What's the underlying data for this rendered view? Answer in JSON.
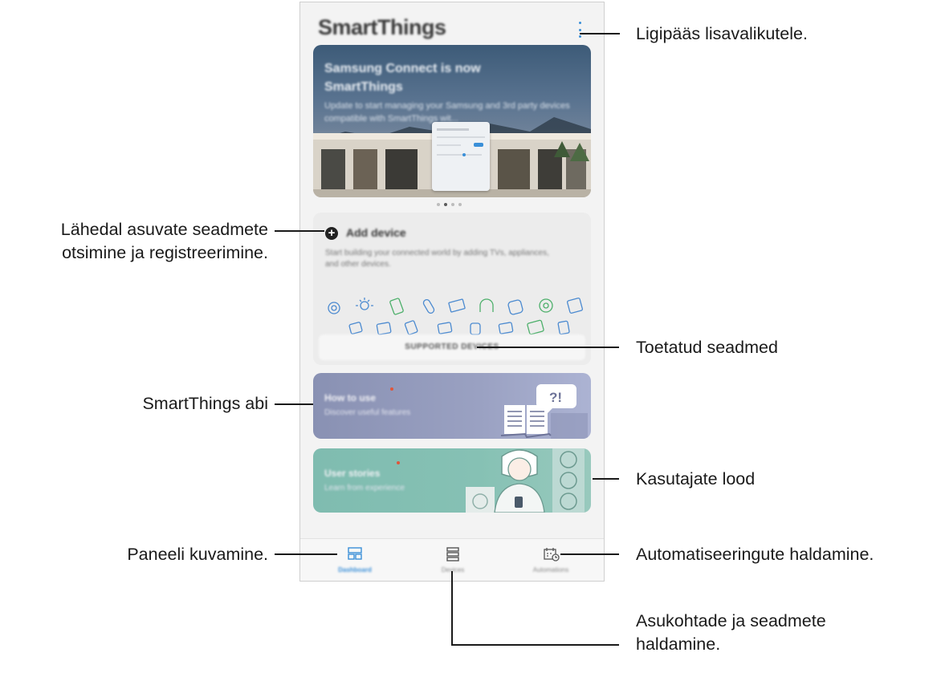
{
  "app": {
    "title": "SmartThings",
    "banner_title": "Samsung Connect is now SmartThings",
    "banner_desc": "Update to start managing your Samsung and 3rd party devices compatible with SmartThings wit...",
    "carousel_pages": 4,
    "carousel_active_page": 2
  },
  "add_device": {
    "title": "Add device",
    "description": "Start building your connected world by adding TVs, appliances, and other devices.",
    "supported_button": "SUPPORTED DEVICES"
  },
  "cards": {
    "how_to_use": {
      "title": "How to use",
      "subtitle": "Discover useful features"
    },
    "user_stories": {
      "title": "User stories",
      "subtitle": "Learn from experience"
    }
  },
  "nav": {
    "dashboard": "Dashboard",
    "devices": "Devices",
    "automations": "Automations"
  },
  "callouts": {
    "more_options": "Ligipääs lisavalikutele.",
    "add_device": [
      "Lähedal asuvate seadmete",
      "otsimine ja registreerimine."
    ],
    "supported": "Toetatud seadmed",
    "help": "SmartThings abi",
    "stories": "Kasutajate lood",
    "dashboard": "Paneeli kuvamine.",
    "automations": "Automatiseeringute haldamine.",
    "devices": [
      "Asukohtade ja seadmete",
      "haldamine."
    ]
  },
  "colors": {
    "accent": "#3a8fd8",
    "notification_dot": "#e0553a",
    "how_to_card": "#9aa1c2",
    "stories_card": "#86c1b4"
  }
}
